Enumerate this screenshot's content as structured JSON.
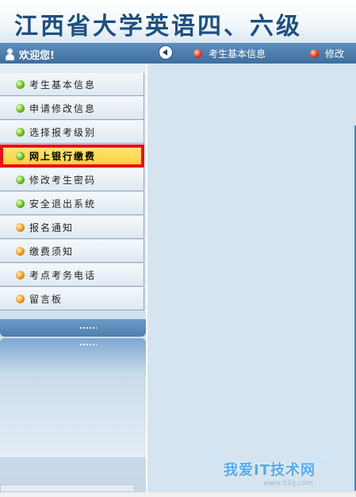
{
  "banner": {
    "title": "江西省大学英语四、六级"
  },
  "topbar": {
    "welcome": "欢迎您!",
    "tabs": [
      {
        "label": "考生基本信息"
      },
      {
        "label": "修改"
      }
    ]
  },
  "sidebar": {
    "items": [
      {
        "label": "考生基本信息",
        "icon": "green"
      },
      {
        "label": "申请修改信息",
        "icon": "green"
      },
      {
        "label": "选择报考级别",
        "icon": "green"
      },
      {
        "label": "网上银行缴费",
        "icon": "green",
        "active": true
      },
      {
        "label": "修改考生密码",
        "icon": "green"
      },
      {
        "label": "安全退出系统",
        "icon": "green"
      },
      {
        "label": "报名通知",
        "icon": "orange"
      },
      {
        "label": "缴费须知",
        "icon": "orange"
      },
      {
        "label": "考点考务电话",
        "icon": "orange"
      },
      {
        "label": "留言板",
        "icon": "orange"
      }
    ]
  },
  "watermark": {
    "text": "我爱IT技术网",
    "url": "www.52ij.com"
  },
  "colors": {
    "active_outline": "#e8101b",
    "active_bg": "#ffd84a",
    "topbar": "#4a7aaa"
  }
}
